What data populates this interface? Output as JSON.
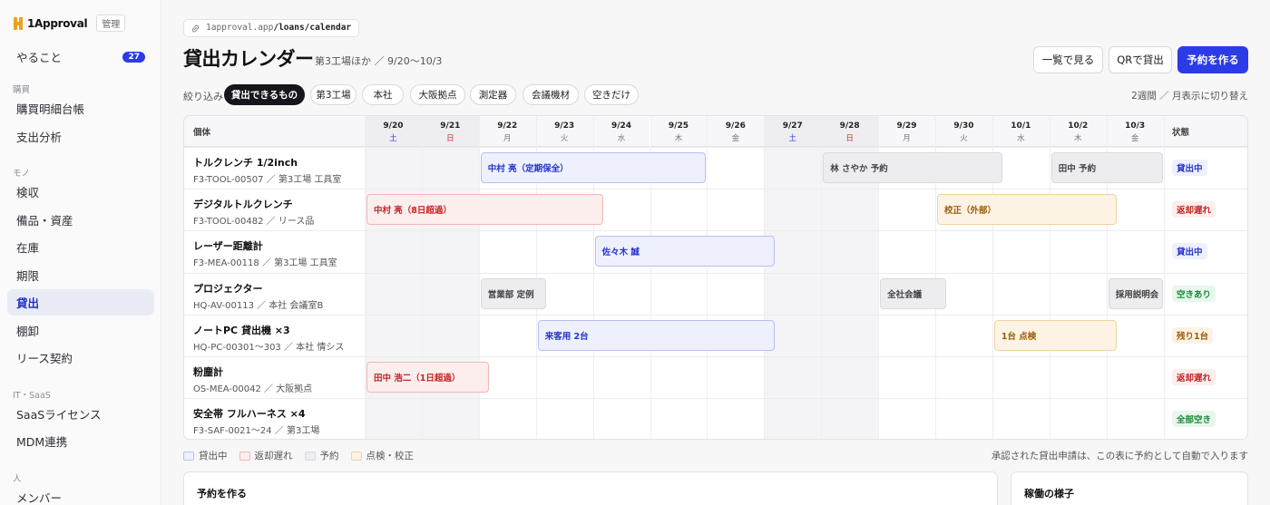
{
  "app": {
    "name": "1Approval",
    "admin_label": "管理"
  },
  "sidebar": {
    "top": [
      {
        "label": "やること",
        "badge": "27"
      }
    ],
    "sections": [
      {
        "title": "購買",
        "items": [
          {
            "label": "購買明細台帳"
          },
          {
            "label": "支出分析"
          }
        ]
      },
      {
        "title": "モノ",
        "items": [
          {
            "label": "検収"
          },
          {
            "label": "備品・資産"
          },
          {
            "label": "在庫"
          },
          {
            "label": "期限"
          },
          {
            "label": "貸出",
            "active": true
          },
          {
            "label": "棚卸"
          },
          {
            "label": "リース契約"
          }
        ]
      },
      {
        "title": "IT・SaaS",
        "items": [
          {
            "label": "SaaSライセンス"
          },
          {
            "label": "MDM連携"
          }
        ]
      },
      {
        "title": "人",
        "items": [
          {
            "label": "メンバー"
          }
        ]
      }
    ]
  },
  "url": {
    "host": "1approval.app",
    "path": "/loans/calendar"
  },
  "header": {
    "title": "貸出カレンダー",
    "subtitle": "第3工場ほか ／ 9/20〜10/3",
    "buttons": {
      "list": "一覧で見る",
      "qr": "QRで貸出",
      "reserve": "予約を作る"
    }
  },
  "filter": {
    "label": "絞り込み",
    "chips": [
      {
        "label": "貸出できるもの",
        "active": true
      },
      {
        "label": "第3工場"
      },
      {
        "label": "本社"
      },
      {
        "label": "大阪拠点"
      },
      {
        "label": "測定器"
      },
      {
        "label": "会議機材"
      },
      {
        "label": "空きだけ"
      }
    ],
    "view_toggle": "2週間 ／ 月表示に切り替え"
  },
  "calendar": {
    "item_header": "個体",
    "status_header": "状態",
    "days": [
      {
        "date": "9/20",
        "weekday": "土",
        "type": "sat"
      },
      {
        "date": "9/21",
        "weekday": "日",
        "type": "sun"
      },
      {
        "date": "9/22",
        "weekday": "月"
      },
      {
        "date": "9/23",
        "weekday": "火"
      },
      {
        "date": "9/24",
        "weekday": "水"
      },
      {
        "date": "9/25",
        "weekday": "木"
      },
      {
        "date": "9/26",
        "weekday": "金"
      },
      {
        "date": "9/27",
        "weekday": "土",
        "type": "sat"
      },
      {
        "date": "9/28",
        "weekday": "日",
        "type": "sun"
      },
      {
        "date": "9/29",
        "weekday": "月"
      },
      {
        "date": "9/30",
        "weekday": "火"
      },
      {
        "date": "10/1",
        "weekday": "水"
      },
      {
        "date": "10/2",
        "weekday": "木"
      },
      {
        "date": "10/3",
        "weekday": "金"
      }
    ],
    "rows": [
      {
        "name": "トルクレンチ 1/2inch",
        "meta": "F3-TOOL-00507 ／ 第3工場 工具室",
        "status": {
          "label": "貸出中",
          "kind": "loan"
        },
        "bars": [
          {
            "label": "中村 亮（定期保全）",
            "kind": "loan",
            "start": 2,
            "end": 6
          },
          {
            "label": "林 さやか 予約",
            "kind": "reserve",
            "start": 8,
            "end": 11.2
          },
          {
            "label": "田中 予約",
            "kind": "reserve",
            "start": 12,
            "end": 14
          }
        ]
      },
      {
        "name": "デジタルトルクレンチ",
        "meta": "F3-TOOL-00482 ／ リース品",
        "status": {
          "label": "返却遅れ",
          "kind": "overdue"
        },
        "bars": [
          {
            "label": "中村 亮（8日超過）",
            "kind": "overdue",
            "start": 0,
            "end": 4.2
          },
          {
            "label": "校正（外部）",
            "kind": "maint",
            "start": 10,
            "end": 13.2
          }
        ]
      },
      {
        "name": "レーザー距離計",
        "meta": "F3-MEA-00118 ／ 第3工場 工具室",
        "status": {
          "label": "貸出中",
          "kind": "loan"
        },
        "bars": [
          {
            "label": "佐々木 誠",
            "kind": "loan",
            "start": 4,
            "end": 7.2
          }
        ]
      },
      {
        "name": "プロジェクター",
        "meta": "HQ-AV-00113 ／ 本社 会議室B",
        "status": {
          "label": "空きあり",
          "kind": "free"
        },
        "bars": [
          {
            "label": "営業部 定例",
            "kind": "reserve",
            "start": 2,
            "end": 3.2
          },
          {
            "label": "全社会議",
            "kind": "reserve",
            "start": 9,
            "end": 10.2
          },
          {
            "label": "採用説明会",
            "kind": "reserve",
            "start": 13,
            "end": 14
          }
        ]
      },
      {
        "name": "ノートPC 貸出機 ×3",
        "meta": "HQ-PC-00301〜303 ／ 本社 情シス",
        "status": {
          "label": "残り1台",
          "kind": "maint"
        },
        "bars": [
          {
            "label": "来客用 2台",
            "kind": "loan",
            "start": 3,
            "end": 7.2
          },
          {
            "label": "1台 点検",
            "kind": "maint",
            "start": 11,
            "end": 13.2
          }
        ]
      },
      {
        "name": "粉塵計",
        "meta": "OS-MEA-00042 ／ 大阪拠点",
        "status": {
          "label": "返却遅れ",
          "kind": "overdue"
        },
        "bars": [
          {
            "label": "田中 浩二（1日超過）",
            "kind": "overdue",
            "start": 0,
            "end": 2.2
          }
        ]
      },
      {
        "name": "安全帯 フルハーネス ×4",
        "meta": "F3-SAF-0021〜24 ／ 第3工場",
        "status": {
          "label": "全部空き",
          "kind": "free"
        },
        "bars": []
      }
    ]
  },
  "legend": [
    {
      "label": "貸出中",
      "kind": "loan"
    },
    {
      "label": "返却遅れ",
      "kind": "overdue"
    },
    {
      "label": "予約",
      "kind": "reserve"
    },
    {
      "label": "点検・校正",
      "kind": "maint"
    }
  ],
  "note": "承認された貸出申請は、この表に予約として自動で入ります",
  "cards": {
    "reserve_title": "予約を作る",
    "activity_title": "稼働の様子"
  }
}
